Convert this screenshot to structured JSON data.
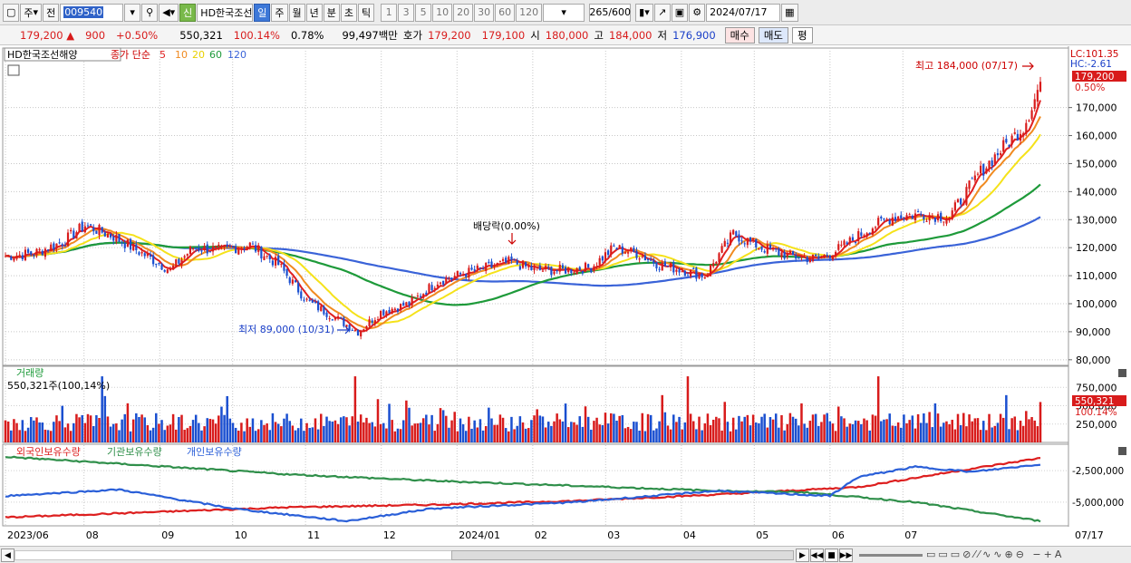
{
  "toolbar": {
    "period_main": "주",
    "prev_label": "전",
    "code": "009540",
    "shin": "신",
    "name": "HD한국조선",
    "periods": [
      "일",
      "주",
      "월",
      "년",
      "분",
      "초",
      "틱"
    ],
    "selected_period": "일",
    "intervals": [
      "1",
      "3",
      "5",
      "10",
      "20",
      "30",
      "60",
      "120"
    ],
    "count": "265",
    "count_total": "/600",
    "date": "2024/07/17"
  },
  "quote": {
    "price": "179,200",
    "arrow": "▲",
    "change": "900",
    "change_pct": "+0.50%",
    "volume": "550,321",
    "vol_ratio": "100.14%",
    "turnover": "0.78%",
    "amount": "99,497백만",
    "ask_label": "호가",
    "ask": "179,200",
    "bid": "179,100",
    "open_label": "시",
    "open": "180,000",
    "high_label": "고",
    "high": "184,000",
    "low_label": "저",
    "low": "176,900",
    "buy_label": "매수",
    "sell_label": "매도",
    "eval_label": "평"
  },
  "legend": {
    "stock_name": "HD한국조선해양",
    "ma_prefix": "종가 단순",
    "ma_labels": [
      "5",
      "10",
      "20",
      "60",
      "120"
    ]
  },
  "annotations": {
    "high_text": "최고 184,000 (07/17)",
    "low_text": "최저 89,000 (10/31)",
    "dividend_text": "배당락(0.00%)",
    "lc_text": "LC:101.35",
    "hc_text": "HC:-2.61",
    "price_tag": "179,200",
    "pct_tag": "0.50%"
  },
  "volume_panel": {
    "title": "거래량",
    "subtitle": "550,321주(100,14%)",
    "tag_value": "550,321",
    "tag_pct": "100.14%"
  },
  "holding_panel": {
    "titles": [
      "외국인보유수량",
      "기관보유수량",
      "개인보유수량"
    ]
  },
  "colors": {
    "up": "#d81b1b",
    "down": "#1a4fd0",
    "ma5": "#e02020",
    "ma10": "#f08a20",
    "ma20": "#f5e21a",
    "ma60": "#1e9a3a",
    "ma120": "#3a63d8",
    "foreign": "#dd1f1f",
    "institution": "#2f8f4a",
    "individual": "#2a5fd8"
  },
  "chart_data": [
    {
      "type": "candlestick",
      "title": "HD한국조선해양",
      "x_labels": [
        "2023/06",
        "08",
        "09",
        "10",
        "11",
        "12",
        "2024/01",
        "02",
        "03",
        "04",
        "05",
        "06",
        "07",
        "07/17"
      ],
      "ylim": [
        78000,
        188000
      ],
      "y_ticks": [
        80000,
        90000,
        100000,
        110000,
        120000,
        130000,
        140000,
        150000,
        160000,
        170000
      ],
      "y_tick_labels": [
        "80,000",
        "90,000",
        "100,000",
        "110,000",
        "120,000",
        "130,000",
        "140,000",
        "150,000",
        "160,000",
        "170,000"
      ],
      "close_anchors": [
        [
          0,
          117000
        ],
        [
          10,
          118000
        ],
        [
          20,
          122000
        ],
        [
          28,
          128000
        ],
        [
          38,
          124000
        ],
        [
          48,
          118000
        ],
        [
          58,
          112000
        ],
        [
          66,
          120000
        ],
        [
          76,
          119000
        ],
        [
          86,
          121000
        ],
        [
          96,
          114000
        ],
        [
          106,
          101000
        ],
        [
          116,
          95000
        ],
        [
          124,
          90000
        ],
        [
          132,
          97000
        ],
        [
          142,
          100000
        ],
        [
          152,
          108000
        ],
        [
          162,
          111000
        ],
        [
          170,
          113000
        ],
        [
          178,
          115000
        ],
        [
          186,
          112000
        ],
        [
          196,
          112000
        ],
        [
          206,
          113000
        ],
        [
          214,
          120000
        ],
        [
          222,
          118000
        ],
        [
          230,
          114000
        ],
        [
          238,
          112000
        ],
        [
          246,
          110000
        ],
        [
          256,
          125000
        ],
        [
          266,
          120000
        ],
        [
          276,
          117000
        ],
        [
          286,
          116000
        ],
        [
          294,
          120000
        ],
        [
          304,
          127000
        ],
        [
          312,
          131000
        ],
        [
          322,
          132000
        ],
        [
          332,
          131000
        ],
        [
          342,
          146000
        ],
        [
          352,
          157000
        ],
        [
          358,
          163000
        ],
        [
          362,
          173000
        ],
        [
          364,
          179200
        ]
      ],
      "high": 184000,
      "low": 89000,
      "ma_periods": [
        5,
        10,
        20,
        60,
        120
      ]
    },
    {
      "type": "bar",
      "title": "거래량",
      "y_ticks": [
        250000,
        500000,
        750000
      ],
      "y_tick_labels": [
        "250,000",
        "500,000",
        "750,000"
      ],
      "ylim": [
        0,
        1000000
      ],
      "last_value": 550321
    },
    {
      "type": "line",
      "title": "보유수량",
      "series": [
        {
          "name": "외국인보유수량",
          "anchors": [
            [
              0,
              -6200000
            ],
            [
              50,
              -5800000
            ],
            [
              100,
              -5400000
            ],
            [
              150,
              -5200000
            ],
            [
              200,
              -4900000
            ],
            [
              250,
              -4400000
            ],
            [
              300,
              -3800000
            ],
            [
              330,
              -2700000
            ],
            [
              364,
              -1500000
            ]
          ]
        },
        {
          "name": "기관보유수량",
          "anchors": [
            [
              0,
              -1400000
            ],
            [
              50,
              -2100000
            ],
            [
              100,
              -2800000
            ],
            [
              150,
              -3300000
            ],
            [
              200,
              -3700000
            ],
            [
              250,
              -4100000
            ],
            [
              280,
              -4200000
            ],
            [
              320,
              -5000000
            ],
            [
              364,
              -6500000
            ]
          ]
        },
        {
          "name": "개인보유수량",
          "anchors": [
            [
              0,
              -4500000
            ],
            [
              40,
              -4000000
            ],
            [
              80,
              -5500000
            ],
            [
              120,
              -6500000
            ],
            [
              150,
              -5500000
            ],
            [
              200,
              -5000000
            ],
            [
              250,
              -4100000
            ],
            [
              290,
              -4500000
            ],
            [
              300,
              -3000000
            ],
            [
              320,
              -2200000
            ],
            [
              340,
              -2600000
            ],
            [
              364,
              -2000000
            ]
          ]
        }
      ],
      "y_ticks": [
        -2500000,
        -5000000
      ],
      "y_tick_labels": [
        "-2,500,000",
        "-5,000,000"
      ],
      "ylim": [
        -6800000,
        -1200000
      ]
    }
  ]
}
